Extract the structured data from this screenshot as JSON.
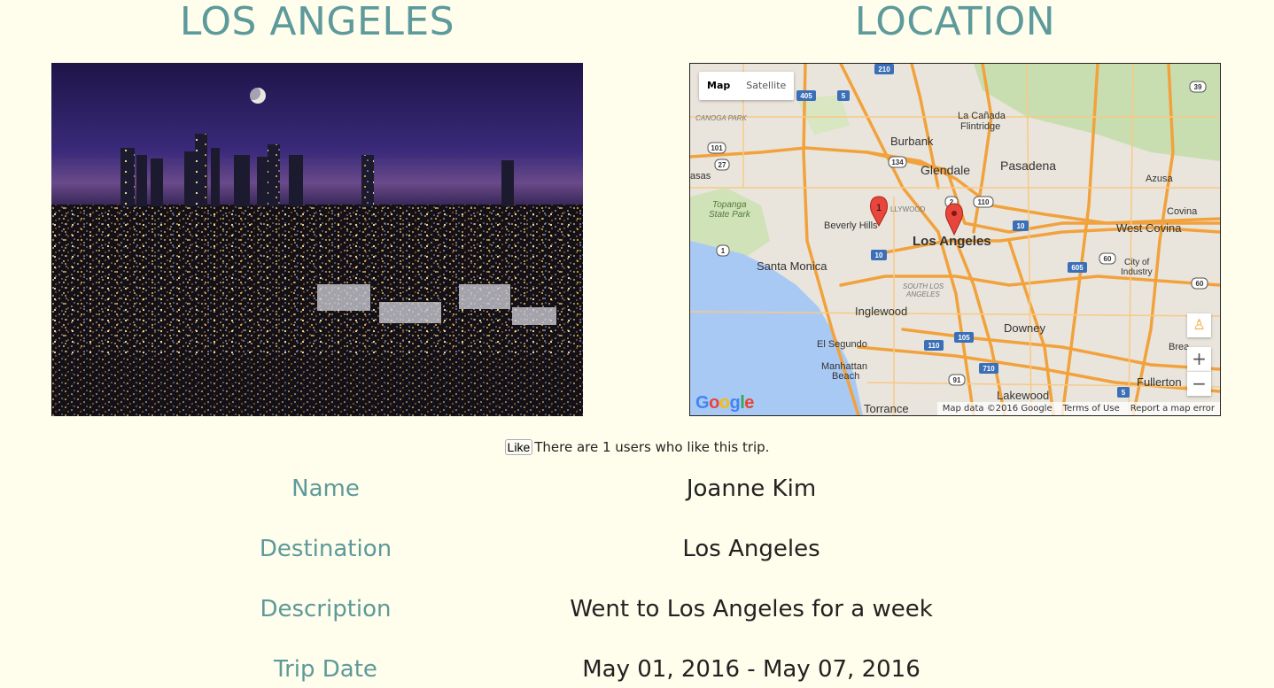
{
  "headings": {
    "city": "LOS ANGELES",
    "location": "LOCATION"
  },
  "map": {
    "tabs": [
      "Map",
      "Satellite"
    ],
    "labels": {
      "canoga_park": "CANOGA PARK",
      "topanga": "Topanga",
      "topanga2": "State Park",
      "burbank": "Burbank",
      "la_canada": "La Cañada",
      "flintridge": "Flintridge",
      "glendale": "Glendale",
      "pasadena": "Pasadena",
      "azusa": "Azusa",
      "covina": "Covina",
      "west_covina": "West Covina",
      "beverly_hills": "Beverly Hills",
      "hollywood": "LLYWOOD",
      "los_angeles": "Los Angeles",
      "santa_monica": "Santa Monica",
      "city_of": "City of",
      "industry": "Industry",
      "south_la": "SOUTH LOS",
      "angeles": "ANGELES",
      "inglewood": "Inglewood",
      "downey": "Downey",
      "el_segundo": "El Segundo",
      "manhattan": "Manhattan",
      "beach": "Beach",
      "lakewood": "Lakewood",
      "fullerton": "Fullerton",
      "torrance": "Torrance",
      "brea": "Brea",
      "asas": "asas"
    },
    "highways": [
      "405",
      "5",
      "210",
      "101",
      "27",
      "134",
      "2",
      "110",
      "10",
      "605",
      "60",
      "1",
      "105",
      "710",
      "91",
      "39"
    ],
    "marker_label": "1",
    "google": {
      "G": "G",
      "o1": "o",
      "o2": "o",
      "g": "g",
      "l": "l",
      "e": "e"
    },
    "footer": [
      "Map data ©2016 Google",
      "Terms of Use",
      "Report a map error"
    ],
    "zoom_in": "+",
    "zoom_out": "−"
  },
  "like": {
    "button": "Like",
    "text": "There are 1 users who like this trip."
  },
  "details": [
    {
      "label": "Name",
      "value": "Joanne Kim"
    },
    {
      "label": "Destination",
      "value": "Los Angeles"
    },
    {
      "label": "Description",
      "value": "Went to Los Angeles for a week"
    },
    {
      "label": "Trip Date",
      "value": "May 01, 2016 - May 07, 2016"
    }
  ],
  "colors": {
    "accent": "#5d9a9b",
    "background": "#fffdeb",
    "highway": "#f2a23c",
    "ocean": "#a9c9f5"
  }
}
